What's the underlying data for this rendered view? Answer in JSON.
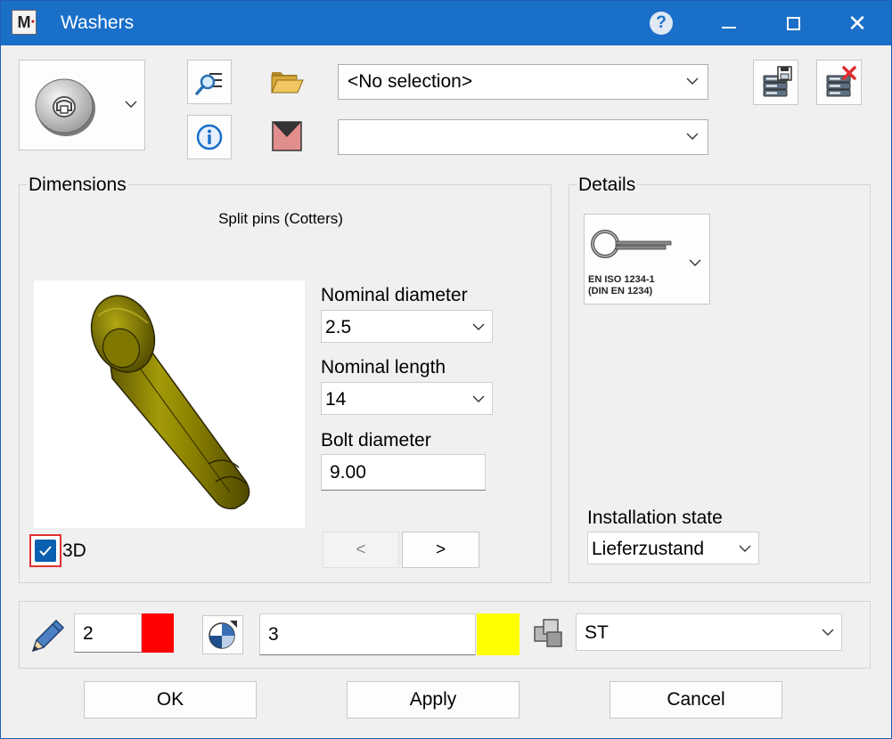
{
  "window": {
    "title": "Washers",
    "app_icon_letter": "M"
  },
  "toolbar": {
    "selection_combo": "<No selection>",
    "second_combo": ""
  },
  "dimensions": {
    "group_label": "Dimensions",
    "subtitle": "Split pins (Cotters)",
    "nominal_diameter_label": "Nominal diameter",
    "nominal_diameter_value": "2.5",
    "nominal_length_label": "Nominal length",
    "nominal_length_value": "14",
    "bolt_diameter_label": "Bolt diameter",
    "bolt_diameter_value": "9.00",
    "view3d_label": "3D",
    "view3d_checked": true,
    "prev_label": "<",
    "next_label": ">"
  },
  "details": {
    "group_label": "Details",
    "standard_line1": "EN ISO 1234-1",
    "standard_line2": "(DIN EN 1234)",
    "installation_label": "Installation state",
    "installation_value": "Lieferzustand"
  },
  "attributes": {
    "pen_value": "2",
    "pen_color": "#ff0000",
    "layer_value": "3",
    "layer_color": "#ffff00",
    "material_value": "ST"
  },
  "footer": {
    "ok_label": "OK",
    "apply_label": "Apply",
    "cancel_label": "Cancel"
  },
  "colors": {
    "titlebar": "#1a6fc9",
    "checkbox_accent": "#0a5fb0",
    "focus_outline": "#e03030",
    "pin_body": "#8a8000"
  }
}
